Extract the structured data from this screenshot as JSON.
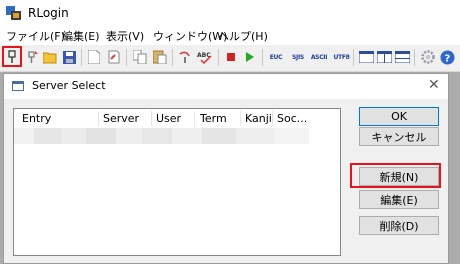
{
  "app": {
    "title": "RLogin"
  },
  "menu": [
    "ファイル(F)",
    "編集(E)",
    "表示(V)",
    "ウィンドウ(W)",
    "ヘルプ(H)"
  ],
  "toolbar": {
    "euc_label": "EUC",
    "sjis_label": "SJIS",
    "ascii_label": "ASCII",
    "utf8_label": "UTF8"
  },
  "dialog": {
    "title": "Server Select",
    "columns": [
      "Entry",
      "Server",
      "User",
      "Term",
      "Kanji",
      "Soc..."
    ],
    "buttons": {
      "ok": "OK",
      "cancel": "キャンセル",
      "new": "新規(N)",
      "edit": "編集(E)",
      "delete": "削除(D)"
    }
  },
  "colors": {
    "highlight": "#e8141b",
    "default_button_border": "#0078d7"
  }
}
